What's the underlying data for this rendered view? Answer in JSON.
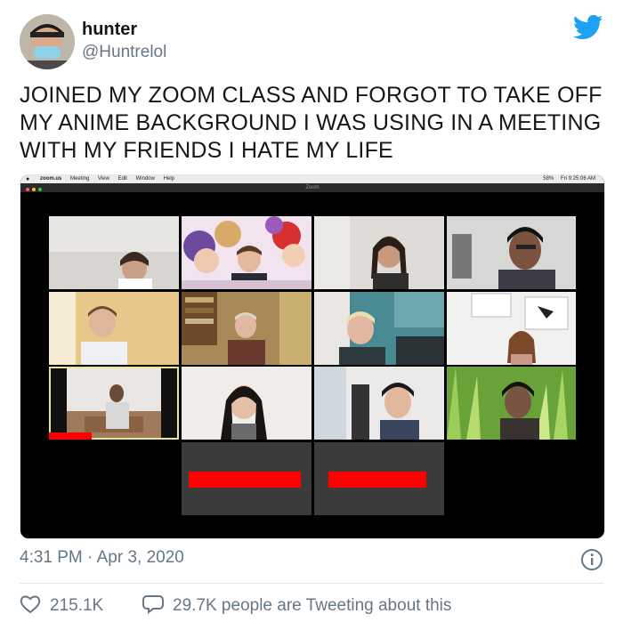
{
  "user": {
    "name": "hunter",
    "handle": "@Huntrelol"
  },
  "tweet_text": "JOINED MY ZOOM CLASS AND FORGOT TO TAKE OFF MY ANIME BACKGROUND I WAS USING IN A MEETING WITH MY FRIENDS I HATE MY LIFE",
  "screenshot": {
    "menubar": {
      "app": "zoom.us",
      "items": [
        "Meeting",
        "View",
        "Edit",
        "Window",
        "Help"
      ],
      "battery": "58%",
      "clock": "Fri 9:25:06 AM"
    },
    "window_title": "Zoom"
  },
  "footer": {
    "timestamp": "4:31 PM · Apr 3, 2020",
    "likes": "215.1K",
    "tweeting": "29.7K people are Tweeting about this"
  },
  "icons": {
    "brand": "twitter-bird-icon",
    "info": "info-icon",
    "like": "heart-icon",
    "reply": "speech-bubble-icon"
  },
  "colors": {
    "twitter_blue": "#1da1f2",
    "muted_text": "#657786",
    "active_speaker": "#e9e59a",
    "zoom_red": "#ff0000"
  }
}
